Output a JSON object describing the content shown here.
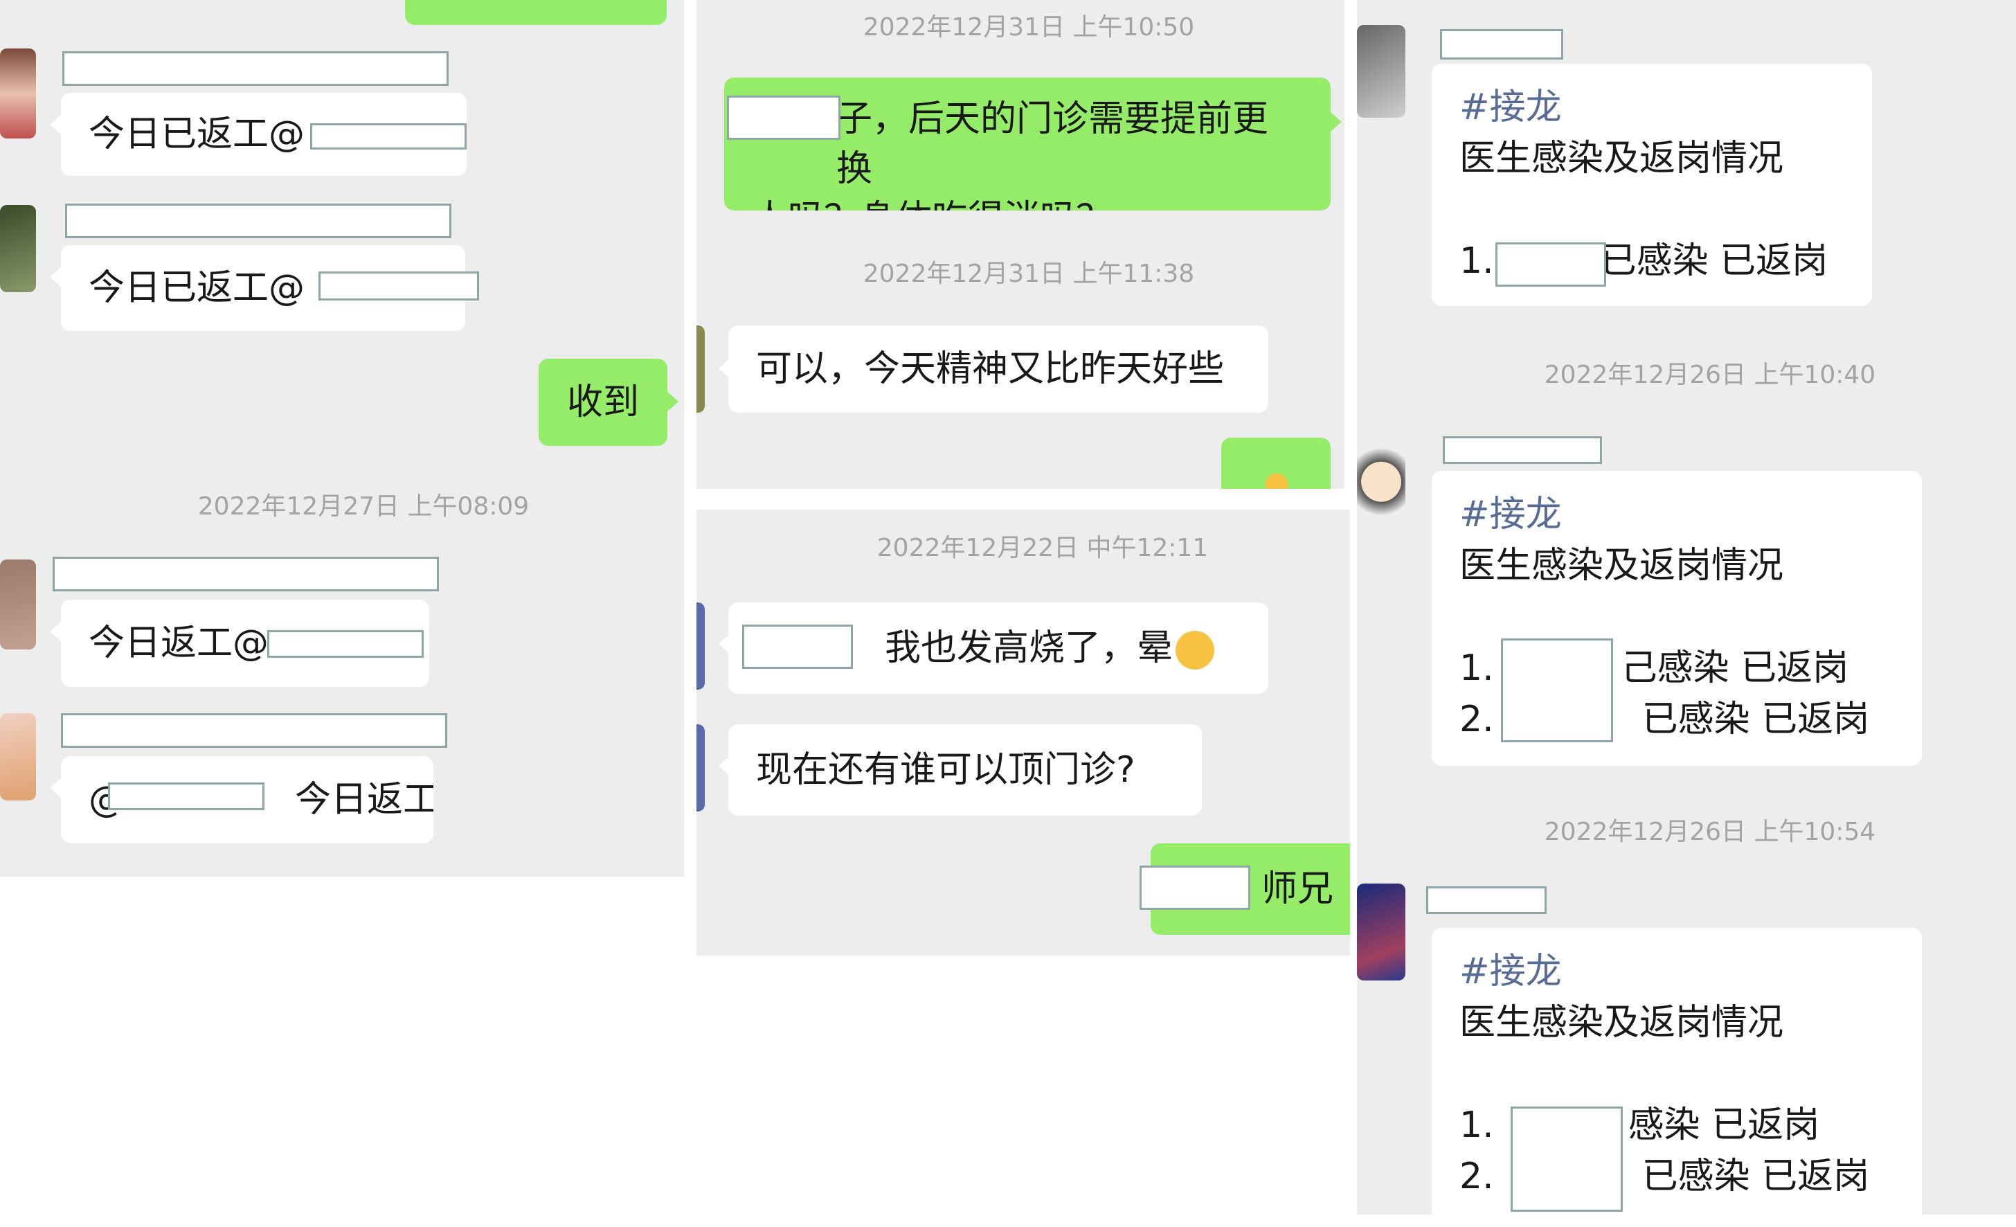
{
  "panel1": {
    "msg1": "今日已返工@",
    "msg2": "今日已返工@",
    "reply": "收到",
    "timestamp": "2022年12月27日 上午08:09",
    "msg3": "今日返工@",
    "msg4_prefix": "@",
    "msg4_suffix": "今日返工"
  },
  "panel2": {
    "timestamp1": "2022年12月31日 上午10:50",
    "green_line1": "子，后天的门诊需要提前更换",
    "green_line2": "人吗？身体吃得消吗？",
    "timestamp2": "2022年12月31日 上午11:38",
    "reply": "可以，今天精神又比昨天好些",
    "timestamp3": "2022年12月22日 中午12:11",
    "msg1": "我也发高烧了，晕",
    "msg2": "现在还有谁可以顶门诊?",
    "green_reply": "师兄"
  },
  "panel3": {
    "card1": {
      "tag": "#接龙",
      "title": "医生感染及返岗情况",
      "item1_prefix": "1.",
      "item1_suffix": "已感染 已返岗"
    },
    "timestamp1": "2022年12月26日 上午10:40",
    "card2": {
      "tag": "#接龙",
      "title": "医生感染及返岗情况",
      "item1_prefix": "1.",
      "item1_suffix": "己感染 已返岗",
      "item2_prefix": "2.",
      "item2_suffix": "已感染 已返岗"
    },
    "timestamp2": "2022年12月26日 上午10:54",
    "card3": {
      "tag": "#接龙",
      "title": "医生感染及返岗情况",
      "item1_prefix": "1.",
      "item1_suffix": "感染 已返岗",
      "item2_prefix": "2.",
      "item2_suffix": "已感染 已返岗"
    }
  },
  "colors": {
    "chat_bg": "#ededed",
    "green_bubble": "#95ec69",
    "white_bubble": "#ffffff",
    "timestamp_text": "#a3a3a3",
    "hashtag": "#576b95",
    "redaction_border": "#8fa6a6"
  },
  "icons": [
    "user-avatar",
    "ok-hand-emoji",
    "crying-laughing-emoji"
  ]
}
